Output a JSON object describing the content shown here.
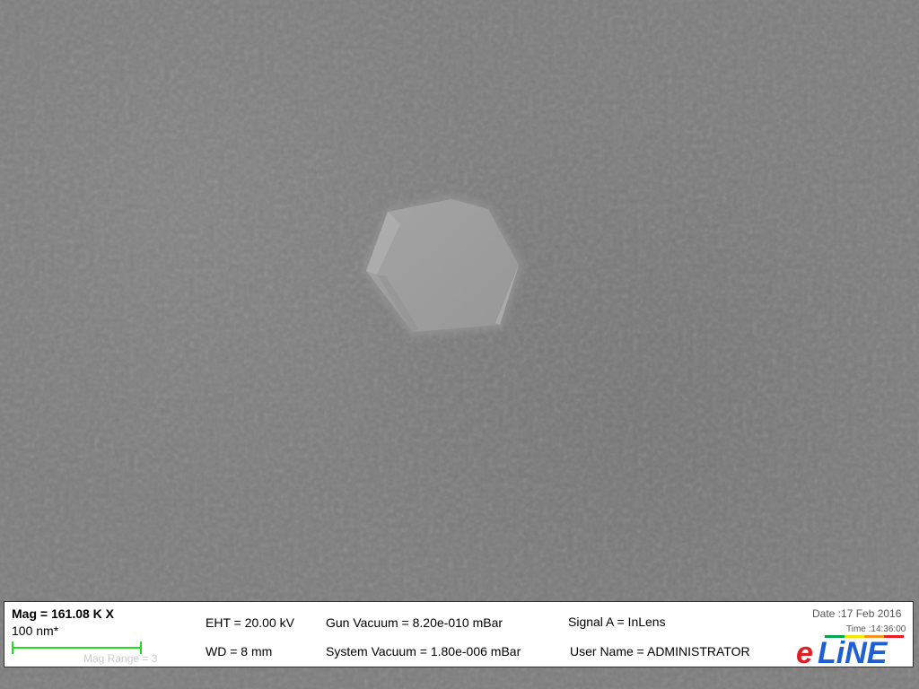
{
  "sem": {
    "magnification": "Mag = 161.08 K X",
    "scale_label": "100 nm*",
    "mag_range": "Mag Range = 3",
    "eht": "EHT = 20.00 kV",
    "wd": "WD =    8 mm",
    "gun_vacuum": "Gun Vacuum = 8.20e-010 mBar",
    "system_vacuum": "System Vacuum = 1.80e-006 mBar",
    "signal": "Signal A = InLens",
    "user_name": "User Name = ADMINISTRATOR",
    "date": "Date :17 Feb 2016",
    "time": "Time :14:36:00"
  },
  "logo": {
    "name": "eLINE",
    "colors": {
      "e": "#e31b23",
      "line": "#1f5fd6",
      "stripes": [
        "#00a651",
        "#f7e400",
        "#f7941d",
        "#ed1c24"
      ]
    }
  },
  "colors": {
    "background": "#7c7c7c",
    "crystal": "#9d9d9d",
    "scale_bar": "#22dd22"
  }
}
